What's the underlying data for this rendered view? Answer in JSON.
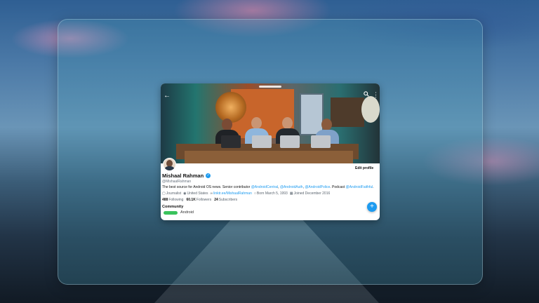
{
  "profile": {
    "name": "Mishaal Rahman",
    "handle": "@MishaalRahman",
    "edit_label": "Edit profile",
    "bio": {
      "text1": "The best source for Android OS news. Senior contributor ",
      "mention1": "@AndroidCentral",
      "sep1": ", ",
      "mention2": "@AndroidAuth",
      "sep2": ", ",
      "mention3": "@AndroidPolice",
      "text2": ". Podcast ",
      "mention4": "@AndroidFaithful",
      "text3": "."
    },
    "meta": {
      "occupation": "Journalist",
      "location": "United States",
      "link": "linktr.ee/MishaalRahman",
      "born": "Born March 5, 1993",
      "joined": "Joined December 2016"
    },
    "stats": {
      "following_count": "488",
      "following_label": "Following",
      "followers_count": "60.1K",
      "followers_label": "Followers",
      "subscribers_count": "24",
      "subscribers_label": "Subscribers"
    },
    "community": {
      "label": "Community",
      "name": "Android"
    }
  },
  "icons": {
    "back": "arrow-left-icon",
    "search": "search-icon",
    "more": "more-vertical-icon",
    "compose": "plus-icon",
    "verified": "verified-badge-icon"
  },
  "colors": {
    "accent": "#1d9bf0",
    "community_pill": "#3ac35c"
  }
}
